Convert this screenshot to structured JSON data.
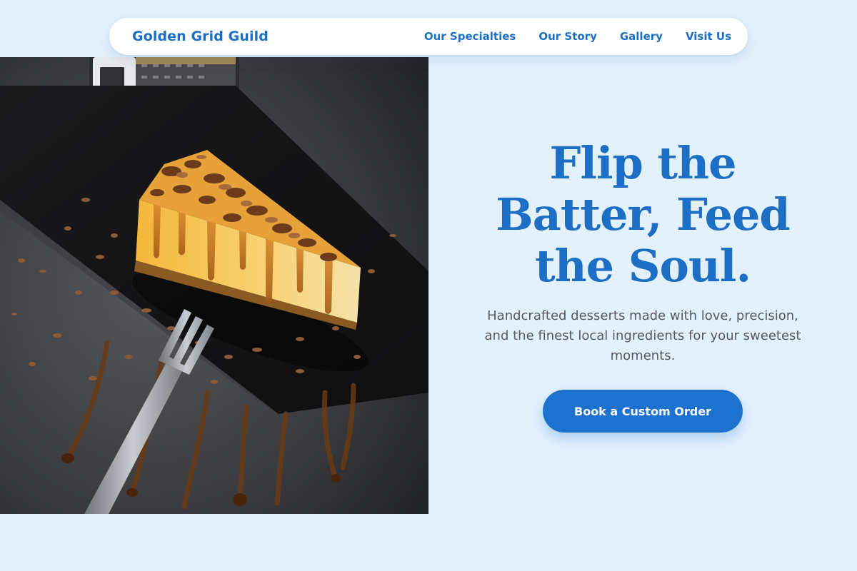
{
  "header": {
    "brand": "Golden Grid Guild",
    "nav": [
      {
        "label": "Our Specialties"
      },
      {
        "label": "Our Story"
      },
      {
        "label": "Gallery"
      },
      {
        "label": "Visit Us"
      }
    ]
  },
  "hero": {
    "headline": "Flip the Batter, Feed the Soul.",
    "subtext": "Handcrafted desserts made with love, precision, and the finest local ingredients for your sweetest moments.",
    "cta_label": "Book a Custom Order",
    "image_subject": "cheesecake-slice-with-chocolate-shavings-and-caramel"
  },
  "colors": {
    "accent": "#1d6fc6",
    "page_background": "#e3f1fd",
    "button": "#1d72cf",
    "body_text": "#555a60"
  }
}
